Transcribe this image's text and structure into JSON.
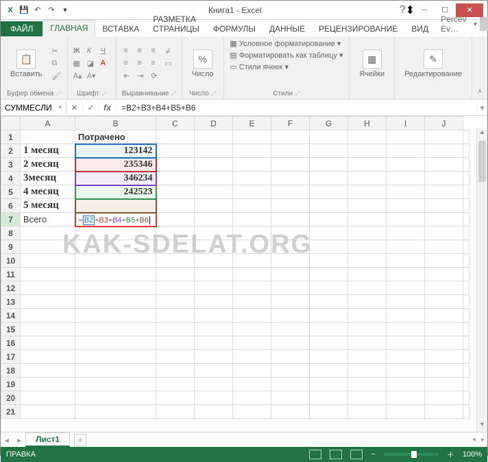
{
  "title": "Книга1 - Excel",
  "qa": {
    "save": "💾",
    "undo": "↶",
    "redo": "↷"
  },
  "user": "Percev Ev…",
  "tabs": {
    "file": "ФАЙЛ",
    "list": [
      "ГЛАВНАЯ",
      "ВСТАВКА",
      "РАЗМЕТКА СТРАНИЦЫ",
      "ФОРМУЛЫ",
      "ДАННЫЕ",
      "РЕЦЕНЗИРОВАНИЕ",
      "ВИД"
    ],
    "active": 0
  },
  "ribbon": {
    "paste": "Вставить",
    "clipboard": "Буфер обмена",
    "font": "Шрифт",
    "align": "Выравнивание",
    "number": "Число",
    "number_btn": "%",
    "styles": "Стили",
    "cond_fmt": "Условное форматирование ▾",
    "fmt_table": "Форматировать как таблицу ▾",
    "cell_styles": "Стили ячеек ▾",
    "cells": "Ячейки",
    "editing": "Редактирование"
  },
  "namebox": "СУММЕСЛИ",
  "fx": "fx",
  "formula": "=B2+B3+B4+B5+B6",
  "cols": [
    "A",
    "B",
    "C",
    "D",
    "E",
    "F",
    "G",
    "H",
    "I",
    "J"
  ],
  "sheet": {
    "b1": "Потрачено",
    "rows": [
      {
        "a": "1 месяц",
        "b": "123142"
      },
      {
        "a": "2 месяц",
        "b": "235346"
      },
      {
        "a": "3месяц",
        "b": "346234"
      },
      {
        "a": "4 месяц",
        "b": "242523"
      },
      {
        "a": "5 месяц",
        "b": ""
      }
    ],
    "a7": "Всего",
    "b7_edit": {
      "p0": "B2",
      "p1": "B3",
      "p2": "B4",
      "p3": "B5",
      "p4": "B6"
    }
  },
  "chart_data": {
    "type": "table",
    "categories": [
      "1 месяц",
      "2 месяц",
      "3месяц",
      "4 месяц",
      "5 месяц"
    ],
    "values": [
      123142,
      235346,
      346234,
      242523,
      null
    ],
    "header": "Потрачено",
    "total_label": "Всего",
    "total_formula": "=B2+B3+B4+B5+B6"
  },
  "sheet_tab": "Лист1",
  "status": {
    "mode": "ПРАВКА",
    "zoom": "100%"
  },
  "watermark": "KAK-SDELAT.ORG"
}
